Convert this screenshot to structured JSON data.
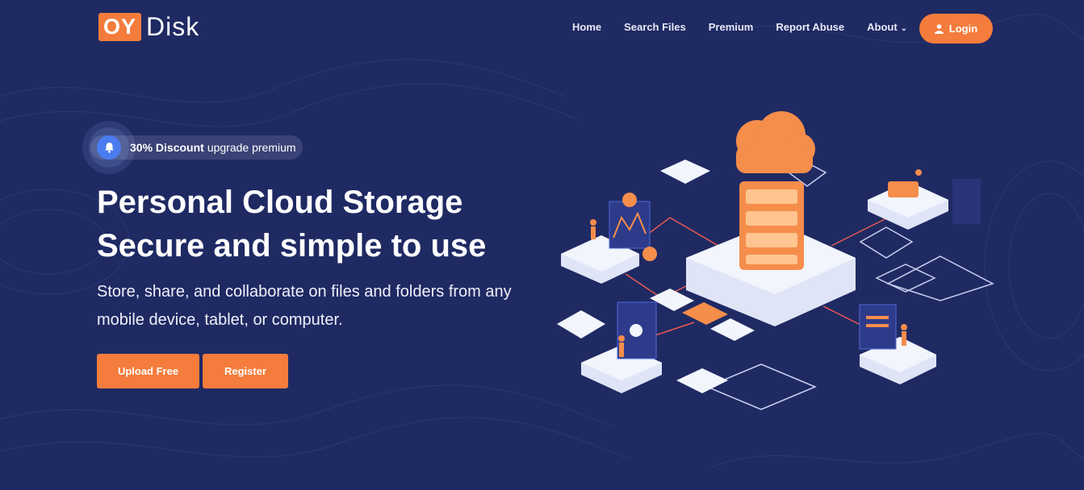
{
  "brand": {
    "logo_box": "OY",
    "logo_text": "Disk"
  },
  "nav": {
    "items": [
      {
        "label": "Home"
      },
      {
        "label": "Search Files"
      },
      {
        "label": "Premium"
      },
      {
        "label": "Report Abuse"
      },
      {
        "label": "About"
      }
    ],
    "login_label": "Login"
  },
  "hero": {
    "badge_bold": "30% Discount",
    "badge_text": "upgrade premium",
    "headline_line1": "Personal Cloud Storage",
    "headline_line2": "Secure and simple to use",
    "subtext": "Store, share, and collaborate on files and folders from any mobile device, tablet, or computer.",
    "upload_label": "Upload Free",
    "register_label": "Register"
  },
  "colors": {
    "background": "#1f2a63",
    "accent": "#f47c3c",
    "bell": "#4a7cf0"
  },
  "icons": [
    "bell-icon",
    "user-icon",
    "chevron-down-icon"
  ]
}
